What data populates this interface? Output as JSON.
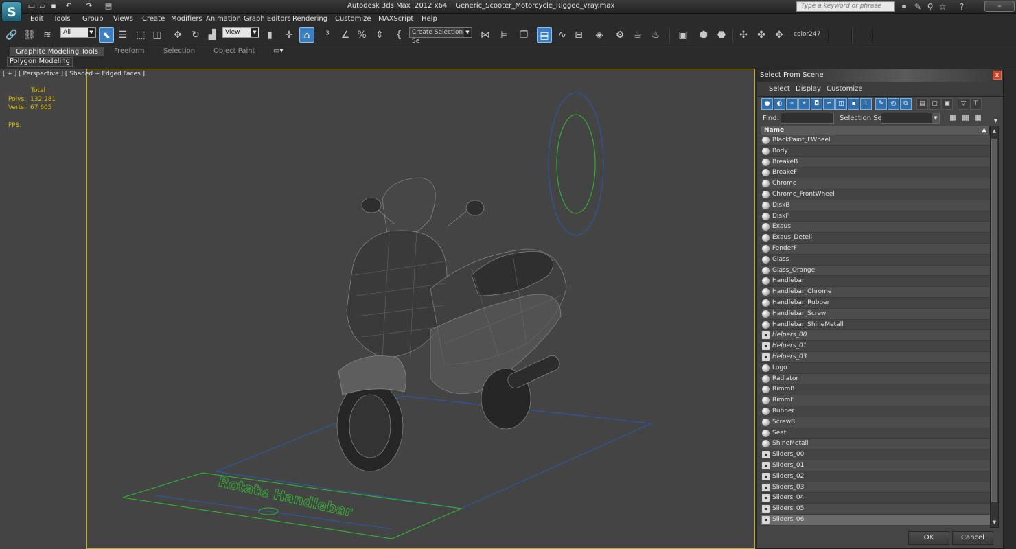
{
  "window": {
    "title_app": "Autodesk 3ds Max  2012 x64",
    "title_file": "Generic_Scooter_Motorcycle_Rigged_vray.max",
    "search_placeholder": "Type a keyword or phrase",
    "app_logo": "S"
  },
  "menu": [
    "Edit",
    "Tools",
    "Group",
    "Views",
    "Create",
    "Modifiers",
    "Animation",
    "Graph Editors",
    "Rendering",
    "Customize",
    "MAXScript",
    "Help"
  ],
  "toolbar": {
    "selection_filter": "All",
    "reference_coord": "View",
    "named_selection": "Create Selection Se",
    "color_label": "color247"
  },
  "ribbon": {
    "tabs": [
      "Graphite Modeling Tools",
      "Freeform",
      "Selection",
      "Object Paint"
    ],
    "panel": "Polygon Modeling"
  },
  "viewport": {
    "label": "[ + ] [ Perspective ] [ Shaded + Edged Faces ]",
    "stats": {
      "total_label": "Total",
      "polys_label": "Polys:",
      "polys_value": "132 281",
      "verts_label": "Verts:",
      "verts_value": "67 605",
      "fps_label": "FPS:"
    },
    "plate_text": "Rotate Handlebar"
  },
  "dialog": {
    "title": "Select From Scene",
    "close": "x",
    "menu": [
      "Select",
      "Display",
      "Customize"
    ],
    "find_label": "Find:",
    "find_value": "",
    "selset_label": "Selection Set:",
    "selset_value": "",
    "column_header": "Name",
    "ok": "OK",
    "cancel": "Cancel",
    "items": [
      {
        "name": "BlackPaint_FWheel",
        "type": "geo"
      },
      {
        "name": "Body",
        "type": "geo"
      },
      {
        "name": "BreakeB",
        "type": "geo"
      },
      {
        "name": "BreakeF",
        "type": "geo"
      },
      {
        "name": "Chrome",
        "type": "geo"
      },
      {
        "name": "Chrome_FrontWheel",
        "type": "geo"
      },
      {
        "name": "DiskB",
        "type": "geo"
      },
      {
        "name": "DiskF",
        "type": "geo"
      },
      {
        "name": "Exaus",
        "type": "geo"
      },
      {
        "name": "Exaus_Deteil",
        "type": "geo"
      },
      {
        "name": "FenderF",
        "type": "geo"
      },
      {
        "name": "Glass",
        "type": "geo"
      },
      {
        "name": "Glass_Orange",
        "type": "geo"
      },
      {
        "name": "Handlebar",
        "type": "geo"
      },
      {
        "name": "Handlebar_Chrome",
        "type": "geo"
      },
      {
        "name": "Handlebar_Rubber",
        "type": "geo"
      },
      {
        "name": "Handlebar_Screw",
        "type": "geo"
      },
      {
        "name": "Handlebar_ShineMetall",
        "type": "geo"
      },
      {
        "name": "Helpers_00",
        "type": "helper"
      },
      {
        "name": "Helpers_01",
        "type": "helper"
      },
      {
        "name": "Helpers_03",
        "type": "helper"
      },
      {
        "name": "Logo",
        "type": "geo"
      },
      {
        "name": "Radiator",
        "type": "geo"
      },
      {
        "name": "RimmB",
        "type": "geo"
      },
      {
        "name": "RimmF",
        "type": "geo"
      },
      {
        "name": "Rubber",
        "type": "geo"
      },
      {
        "name": "ScrewB",
        "type": "geo"
      },
      {
        "name": "Seat",
        "type": "geo"
      },
      {
        "name": "ShineMetall",
        "type": "geo"
      },
      {
        "name": "Sliders_00",
        "type": "helper"
      },
      {
        "name": "Sliders_01",
        "type": "helper"
      },
      {
        "name": "Sliders_02",
        "type": "helper"
      },
      {
        "name": "Sliders_03",
        "type": "helper"
      },
      {
        "name": "Sliders_04",
        "type": "helper"
      },
      {
        "name": "Sliders_05",
        "type": "helper"
      },
      {
        "name": "Sliders_06",
        "type": "helper",
        "selected": true
      }
    ]
  },
  "colors": {
    "background": "#2b2b2b",
    "viewport": "#444444",
    "viewport_border": "#c8b400",
    "stats_text": "#e0c000",
    "accent_blue": "#3c7fc0",
    "helper_green": "#30c030",
    "helper_blue": "#2a5ab0"
  }
}
